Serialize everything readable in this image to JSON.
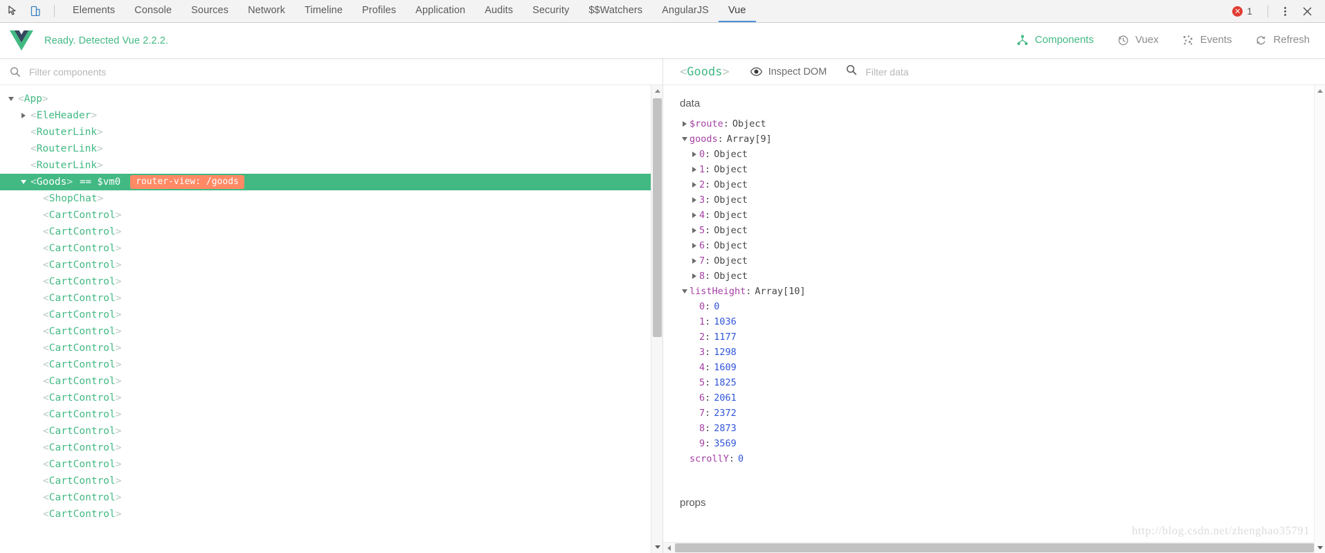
{
  "devtools_bar": {
    "icons": [
      {
        "name": "inspect-element-icon",
        "glyph": "cursor"
      },
      {
        "name": "device-toolbar-icon",
        "glyph": "device"
      }
    ],
    "tabs": [
      {
        "label": "Elements",
        "active": false
      },
      {
        "label": "Console",
        "active": false
      },
      {
        "label": "Sources",
        "active": false
      },
      {
        "label": "Network",
        "active": false
      },
      {
        "label": "Timeline",
        "active": false
      },
      {
        "label": "Profiles",
        "active": false
      },
      {
        "label": "Application",
        "active": false
      },
      {
        "label": "Audits",
        "active": false
      },
      {
        "label": "Security",
        "active": false
      },
      {
        "label": "$$Watchers",
        "active": false
      },
      {
        "label": "AngularJS",
        "active": false
      },
      {
        "label": "Vue",
        "active": true
      }
    ],
    "error_count": "1",
    "error_icon": "error-circle-icon",
    "more_icon": "more-vertical-icon",
    "close_icon": "close-icon"
  },
  "vue_header": {
    "logo_icon": "vue-logo-icon",
    "status": "Ready. Detected Vue 2.2.2.",
    "nav": [
      {
        "label": "Components",
        "icon": "components-tree-icon",
        "active": true
      },
      {
        "label": "Vuex",
        "icon": "clock-history-icon",
        "active": false
      },
      {
        "label": "Events",
        "icon": "events-scatter-icon",
        "active": false
      },
      {
        "label": "Refresh",
        "icon": "refresh-icon",
        "active": false
      }
    ]
  },
  "left_pane": {
    "filter": {
      "icon": "search-icon",
      "placeholder": "Filter components",
      "value": ""
    },
    "tree": [
      {
        "name": "App",
        "indent": 0,
        "arrow": "down",
        "selected": false
      },
      {
        "name": "EleHeader",
        "indent": 1,
        "arrow": "right",
        "selected": false
      },
      {
        "name": "RouterLink",
        "indent": 1,
        "arrow": "none",
        "selected": false
      },
      {
        "name": "RouterLink",
        "indent": 1,
        "arrow": "none",
        "selected": false
      },
      {
        "name": "RouterLink",
        "indent": 1,
        "arrow": "none",
        "selected": false
      },
      {
        "name": "Goods",
        "indent": 1,
        "arrow": "down",
        "selected": true,
        "vm": "== $vm0",
        "badge": "router-view: /goods"
      },
      {
        "name": "ShopChat",
        "indent": 2,
        "arrow": "none",
        "selected": false
      },
      {
        "name": "CartControl",
        "indent": 2,
        "arrow": "none",
        "selected": false
      },
      {
        "name": "CartControl",
        "indent": 2,
        "arrow": "none",
        "selected": false
      },
      {
        "name": "CartControl",
        "indent": 2,
        "arrow": "none",
        "selected": false
      },
      {
        "name": "CartControl",
        "indent": 2,
        "arrow": "none",
        "selected": false
      },
      {
        "name": "CartControl",
        "indent": 2,
        "arrow": "none",
        "selected": false
      },
      {
        "name": "CartControl",
        "indent": 2,
        "arrow": "none",
        "selected": false
      },
      {
        "name": "CartControl",
        "indent": 2,
        "arrow": "none",
        "selected": false
      },
      {
        "name": "CartControl",
        "indent": 2,
        "arrow": "none",
        "selected": false
      },
      {
        "name": "CartControl",
        "indent": 2,
        "arrow": "none",
        "selected": false
      },
      {
        "name": "CartControl",
        "indent": 2,
        "arrow": "none",
        "selected": false
      },
      {
        "name": "CartControl",
        "indent": 2,
        "arrow": "none",
        "selected": false
      },
      {
        "name": "CartControl",
        "indent": 2,
        "arrow": "none",
        "selected": false
      },
      {
        "name": "CartControl",
        "indent": 2,
        "arrow": "none",
        "selected": false
      },
      {
        "name": "CartControl",
        "indent": 2,
        "arrow": "none",
        "selected": false
      },
      {
        "name": "CartControl",
        "indent": 2,
        "arrow": "none",
        "selected": false
      },
      {
        "name": "CartControl",
        "indent": 2,
        "arrow": "none",
        "selected": false
      },
      {
        "name": "CartControl",
        "indent": 2,
        "arrow": "none",
        "selected": false
      },
      {
        "name": "CartControl",
        "indent": 2,
        "arrow": "none",
        "selected": false
      },
      {
        "name": "CartControl",
        "indent": 2,
        "arrow": "none",
        "selected": false
      }
    ]
  },
  "right_pane": {
    "component_title": "Goods",
    "inspect_dom": {
      "label": "Inspect DOM",
      "icon": "eye-icon"
    },
    "data_filter": {
      "icon": "search-icon",
      "placeholder": "Filter data",
      "value": ""
    },
    "sections": [
      {
        "title": "data",
        "rows": [
          {
            "key": "$route",
            "value": "Object",
            "type": "obj",
            "indent": 0,
            "arrow": "right"
          },
          {
            "key": "goods",
            "value": "Array[9]",
            "type": "obj",
            "indent": 0,
            "arrow": "down"
          },
          {
            "key": "0",
            "value": "Object",
            "type": "obj",
            "indent": 1,
            "arrow": "right"
          },
          {
            "key": "1",
            "value": "Object",
            "type": "obj",
            "indent": 1,
            "arrow": "right"
          },
          {
            "key": "2",
            "value": "Object",
            "type": "obj",
            "indent": 1,
            "arrow": "right"
          },
          {
            "key": "3",
            "value": "Object",
            "type": "obj",
            "indent": 1,
            "arrow": "right"
          },
          {
            "key": "4",
            "value": "Object",
            "type": "obj",
            "indent": 1,
            "arrow": "right"
          },
          {
            "key": "5",
            "value": "Object",
            "type": "obj",
            "indent": 1,
            "arrow": "right"
          },
          {
            "key": "6",
            "value": "Object",
            "type": "obj",
            "indent": 1,
            "arrow": "right"
          },
          {
            "key": "7",
            "value": "Object",
            "type": "obj",
            "indent": 1,
            "arrow": "right"
          },
          {
            "key": "8",
            "value": "Object",
            "type": "obj",
            "indent": 1,
            "arrow": "right"
          },
          {
            "key": "listHeight",
            "value": "Array[10]",
            "type": "obj",
            "indent": 0,
            "arrow": "down"
          },
          {
            "key": "0",
            "value": "0",
            "type": "num",
            "indent": 1,
            "arrow": "none"
          },
          {
            "key": "1",
            "value": "1036",
            "type": "num",
            "indent": 1,
            "arrow": "none"
          },
          {
            "key": "2",
            "value": "1177",
            "type": "num",
            "indent": 1,
            "arrow": "none"
          },
          {
            "key": "3",
            "value": "1298",
            "type": "num",
            "indent": 1,
            "arrow": "none"
          },
          {
            "key": "4",
            "value": "1609",
            "type": "num",
            "indent": 1,
            "arrow": "none"
          },
          {
            "key": "5",
            "value": "1825",
            "type": "num",
            "indent": 1,
            "arrow": "none"
          },
          {
            "key": "6",
            "value": "2061",
            "type": "num",
            "indent": 1,
            "arrow": "none"
          },
          {
            "key": "7",
            "value": "2372",
            "type": "num",
            "indent": 1,
            "arrow": "none"
          },
          {
            "key": "8",
            "value": "2873",
            "type": "num",
            "indent": 1,
            "arrow": "none"
          },
          {
            "key": "9",
            "value": "3569",
            "type": "num",
            "indent": 1,
            "arrow": "none"
          },
          {
            "key": "scrollY",
            "value": "0",
            "type": "num",
            "indent": 0,
            "arrow": "none"
          }
        ]
      },
      {
        "title": "props",
        "rows": []
      }
    ]
  },
  "watermark": "http://blog.csdn.net/zhenghao35791"
}
